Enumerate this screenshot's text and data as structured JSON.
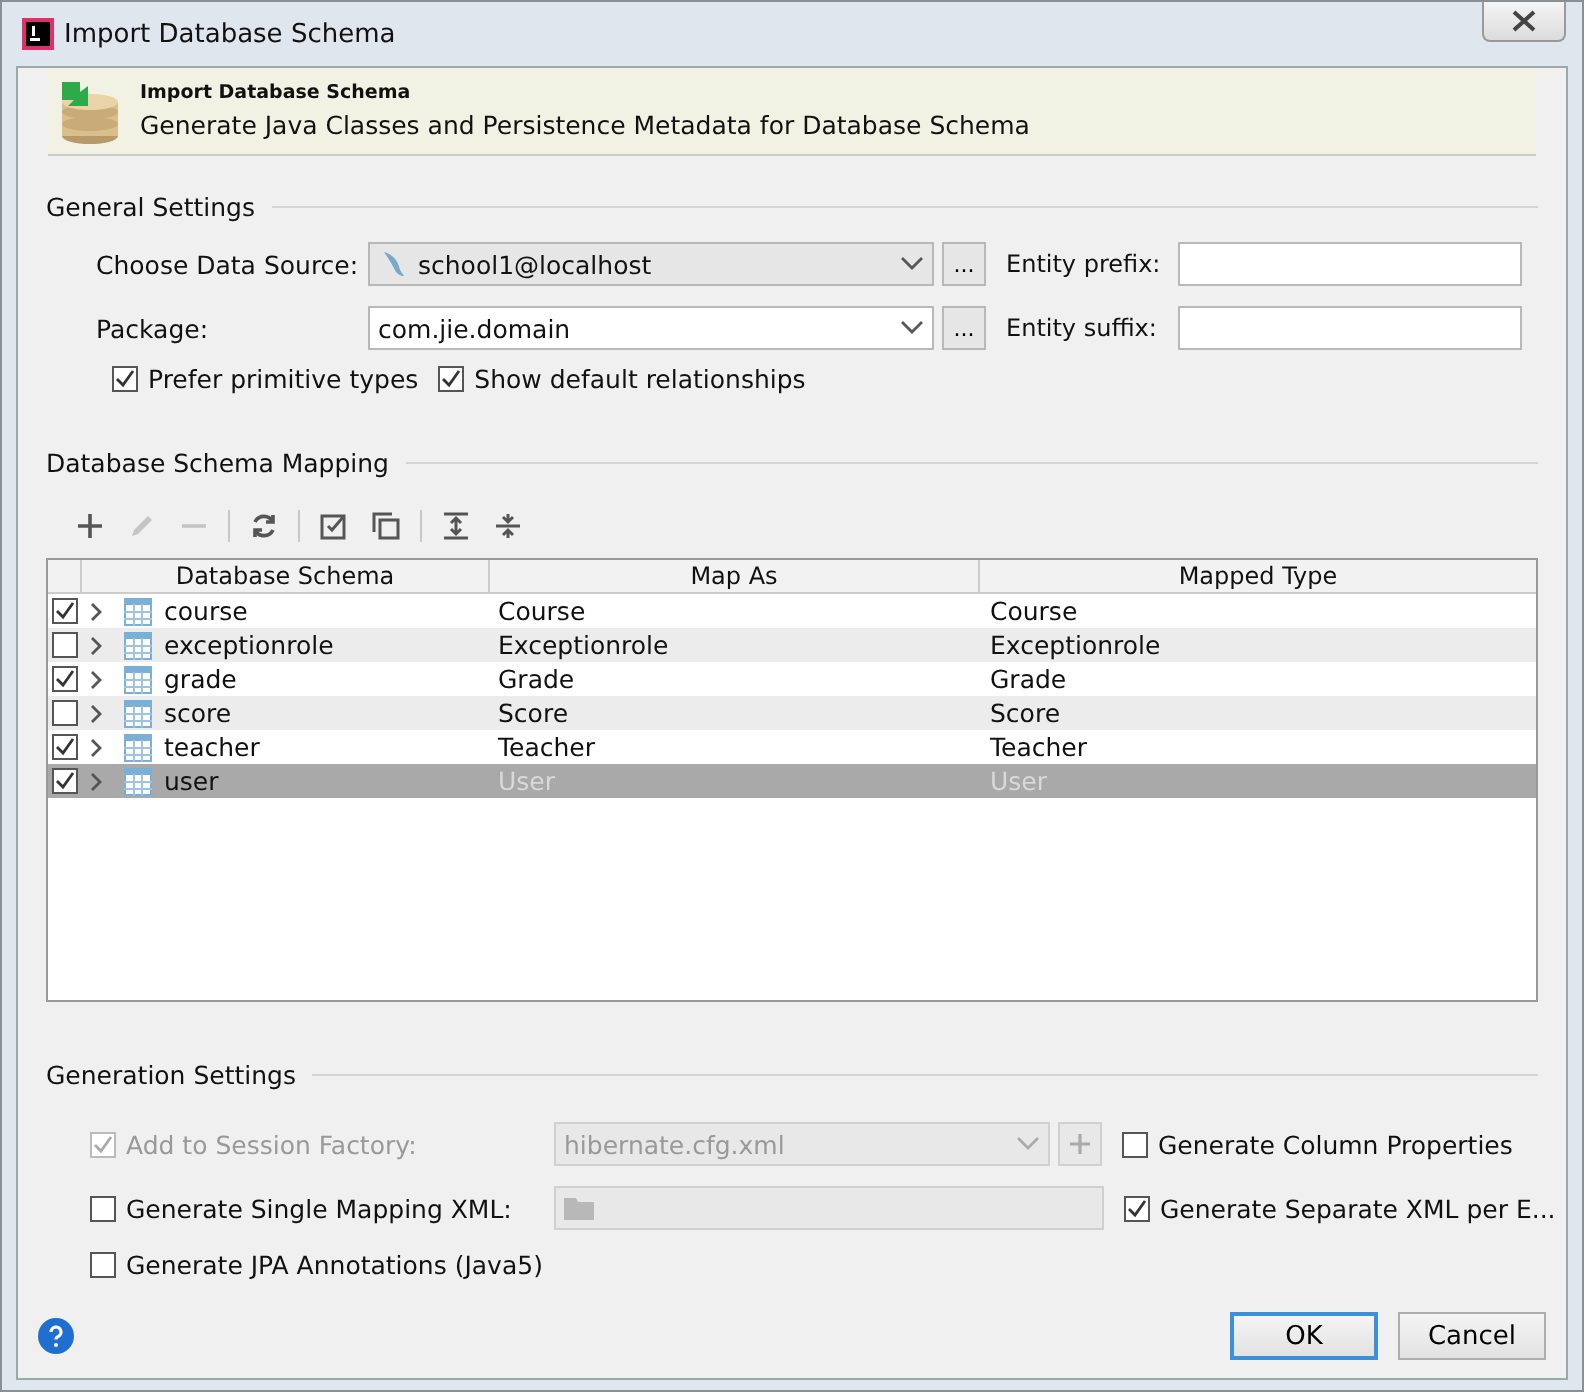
{
  "window": {
    "title": "Import Database Schema"
  },
  "header": {
    "title": "Import Database Schema",
    "subtitle": "Generate Java Classes and Persistence Metadata for Database Schema"
  },
  "general_settings": {
    "title": "General Settings",
    "data_source": {
      "label": "Choose Data Source:",
      "value": "school1@localhost",
      "browse": "..."
    },
    "package": {
      "label": "Package:",
      "value": "com.jie.domain",
      "browse": "..."
    },
    "entity_prefix": {
      "label": "Entity prefix:"
    },
    "entity_suffix": {
      "label": "Entity suffix:"
    },
    "options": [
      {
        "label": "Prefer primitive types",
        "checked": true
      },
      {
        "label": "Show default relationships",
        "checked": true
      }
    ]
  },
  "mapping": {
    "title": "Database Schema Mapping",
    "toolbar": [
      [
        {
          "kind": "add",
          "disabled": false
        },
        {
          "kind": "edit",
          "disabled": true
        },
        {
          "kind": "remove",
          "disabled": true
        }
      ],
      [
        {
          "kind": "refresh",
          "disabled": false
        }
      ],
      [
        {
          "kind": "check-all",
          "disabled": false
        },
        {
          "kind": "copy",
          "disabled": false
        }
      ],
      [
        {
          "kind": "expand",
          "disabled": false
        },
        {
          "kind": "collapse",
          "disabled": false
        }
      ]
    ],
    "columns": [
      "Database Schema",
      "Map As",
      "Mapped Type"
    ],
    "rows": [
      {
        "name": "course",
        "map_as": "Course",
        "mapped_type": "Course",
        "checked": true,
        "selected": false
      },
      {
        "name": "exceptionrole",
        "map_as": "Exceptionrole",
        "mapped_type": "Exceptionrole",
        "checked": false,
        "selected": false
      },
      {
        "name": "grade",
        "map_as": "Grade",
        "mapped_type": "Grade",
        "checked": true,
        "selected": false
      },
      {
        "name": "score",
        "map_as": "Score",
        "mapped_type": "Score",
        "checked": false,
        "selected": false
      },
      {
        "name": "teacher",
        "map_as": "Teacher",
        "mapped_type": "Teacher",
        "checked": true,
        "selected": false
      },
      {
        "name": "user",
        "map_as": "User",
        "mapped_type": "User",
        "checked": true,
        "selected": true
      }
    ]
  },
  "generation": {
    "title": "Generation Settings",
    "session_factory": {
      "label": "Add to Session Factory:",
      "checked": true,
      "disabled": true,
      "value": "hibernate.cfg.xml"
    },
    "single_mapping": {
      "label": "Generate Single Mapping XML:",
      "checked": false
    },
    "jpa": {
      "label": "Generate JPA Annotations (Java5)",
      "checked": false
    },
    "column_properties": {
      "label": "Generate Column Properties",
      "checked": false
    },
    "separate_xml": {
      "label": "Generate Separate XML per E...",
      "checked": true
    }
  },
  "buttons": [
    {
      "label": "OK",
      "default": true
    },
    {
      "label": "Cancel",
      "default": false
    }
  ]
}
